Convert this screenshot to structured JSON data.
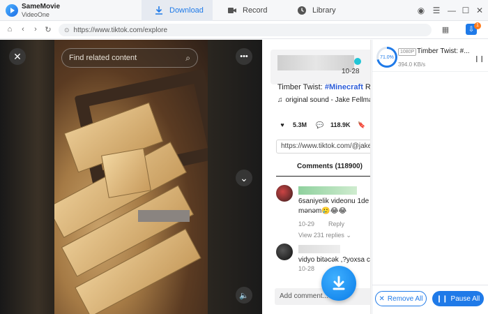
{
  "app": {
    "name": "SameMovie",
    "subtitle": "VideoOne"
  },
  "tabs": [
    {
      "label": "Download",
      "icon": "download-icon",
      "active": true
    },
    {
      "label": "Record",
      "icon": "video-camera-icon",
      "active": false
    },
    {
      "label": "Library",
      "icon": "clock-icon",
      "active": false
    }
  ],
  "address": {
    "url": "https://www.tiktok.com/explore"
  },
  "video": {
    "search_placeholder": "Find related content"
  },
  "detail": {
    "date_fragment": "10-28",
    "description_prefix": "Timber Twist: ",
    "description_tag": "#Minecraft",
    "description_suffix": " RTX",
    "sound": "original sound - Jake Fellman",
    "likes": "5.3M",
    "comments_count": "118.9K",
    "link": "https://www.tiktok.com/@jakefe",
    "comments_tab": "Comments (118900)",
    "comments": [
      {
        "text_line1": "6saniyelik videonu 1de",
        "text_line2": "mənəm🥲😂😂",
        "date": "10-29",
        "reply": "Reply",
        "replies": "View 231 replies"
      },
      {
        "text_line1": "vidyo bitəcək ,?yoxsa c",
        "date": "10-28"
      }
    ],
    "add_comment_placeholder": "Add comment..."
  },
  "downloads": {
    "badge_count": "1",
    "item": {
      "progress_label": "71.0%",
      "progress": 0.71,
      "resolution": "1080P",
      "title": "Timber Twist: #...",
      "speed": "394.0 KB/s"
    },
    "remove_all": "Remove All",
    "pause_all": "Pause All"
  },
  "colors": {
    "accent": "#1f7ae8",
    "tag": "#2b5bd7"
  }
}
